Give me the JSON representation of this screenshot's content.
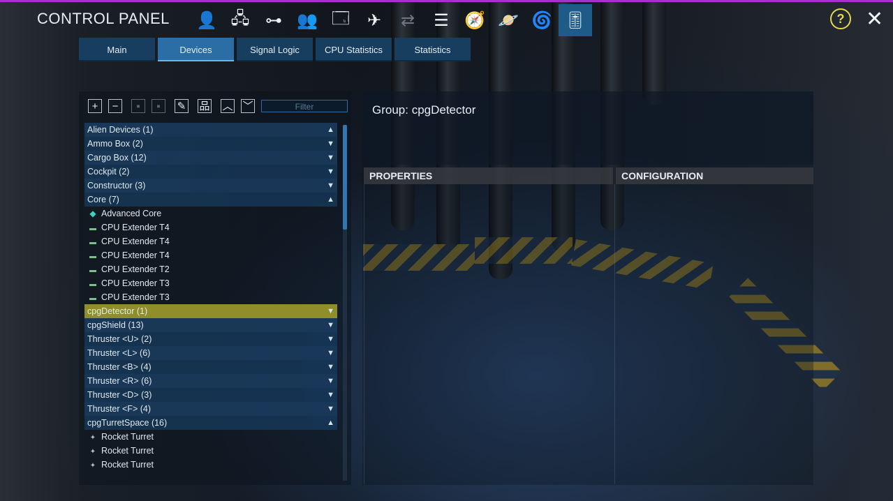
{
  "header": {
    "title": "CONTROL PANEL",
    "icons": [
      {
        "name": "player-icon",
        "glyph": "👤",
        "state": "normal"
      },
      {
        "name": "network-icon",
        "glyph": "🖧",
        "state": "normal"
      },
      {
        "name": "structure-icon",
        "glyph": "⊶",
        "state": "normal"
      },
      {
        "name": "faction-icon",
        "glyph": "👥",
        "state": "normal"
      },
      {
        "name": "window-icon",
        "glyph": "🗔",
        "state": "normal"
      },
      {
        "name": "ship-icon",
        "glyph": "✈",
        "state": "normal"
      },
      {
        "name": "transfer-icon",
        "glyph": "⇄",
        "state": "dim"
      },
      {
        "name": "list-icon",
        "glyph": "☰",
        "state": "normal"
      },
      {
        "name": "compass-icon",
        "glyph": "🧭",
        "state": "normal"
      },
      {
        "name": "planet-icon",
        "glyph": "🪐",
        "state": "normal"
      },
      {
        "name": "galaxy-icon",
        "glyph": "🌀",
        "state": "normal"
      },
      {
        "name": "sliders-icon",
        "glyph": "🎚",
        "state": "active"
      }
    ],
    "help": "?",
    "close": "✕"
  },
  "tabs": [
    {
      "label": "Main",
      "active": false
    },
    {
      "label": "Devices",
      "active": true
    },
    {
      "label": "Signal Logic",
      "active": false
    },
    {
      "label": "CPU Statistics",
      "active": false
    },
    {
      "label": "Statistics",
      "active": false
    }
  ],
  "toolbar": {
    "buttons": [
      {
        "name": "add-icon",
        "glyph": "+",
        "enabled": true
      },
      {
        "name": "remove-icon",
        "glyph": "−",
        "enabled": true
      },
      {
        "name": "copy-icon",
        "glyph": "▪",
        "enabled": false
      },
      {
        "name": "paste-icon",
        "glyph": "▪",
        "enabled": false
      },
      {
        "name": "rename-icon",
        "glyph": "✎",
        "enabled": true
      },
      {
        "name": "hierarchy-icon",
        "glyph": "品",
        "enabled": true
      },
      {
        "name": "move-up-icon",
        "glyph": "︿",
        "enabled": true
      },
      {
        "name": "move-down-icon",
        "glyph": "﹀",
        "enabled": true
      }
    ],
    "filter_placeholder": "Filter"
  },
  "devices": [
    {
      "label": "Alien Devices (1)",
      "type": "group",
      "expanded": true
    },
    {
      "label": "Ammo Box (2)",
      "type": "group",
      "expanded": false
    },
    {
      "label": "Cargo Box (12)",
      "type": "group",
      "expanded": false
    },
    {
      "label": "Cockpit (2)",
      "type": "group",
      "expanded": false
    },
    {
      "label": "Constructor (3)",
      "type": "group",
      "expanded": false
    },
    {
      "label": "Core (7)",
      "type": "group",
      "expanded": true
    },
    {
      "label": "Advanced Core",
      "type": "child",
      "icon": "core"
    },
    {
      "label": "CPU Extender T4",
      "type": "child",
      "icon": "cpu"
    },
    {
      "label": "CPU Extender T4",
      "type": "child",
      "icon": "cpu"
    },
    {
      "label": "CPU Extender T4",
      "type": "child",
      "icon": "cpu"
    },
    {
      "label": "CPU Extender T2",
      "type": "child",
      "icon": "cpu"
    },
    {
      "label": "CPU Extender T3",
      "type": "child",
      "icon": "cpu"
    },
    {
      "label": "CPU Extender T3",
      "type": "child",
      "icon": "cpu"
    },
    {
      "label": "cpgDetector (1)",
      "type": "group",
      "expanded": false,
      "selected": true
    },
    {
      "label": "cpgShield (13)",
      "type": "group",
      "expanded": false
    },
    {
      "label": "Thruster <U> (2)",
      "type": "group",
      "expanded": false
    },
    {
      "label": "Thruster <L> (6)",
      "type": "group",
      "expanded": false
    },
    {
      "label": "Thruster <B> (4)",
      "type": "group",
      "expanded": false
    },
    {
      "label": "Thruster <R> (6)",
      "type": "group",
      "expanded": false
    },
    {
      "label": "Thruster <D> (3)",
      "type": "group",
      "expanded": false
    },
    {
      "label": "Thruster <F> (4)",
      "type": "group",
      "expanded": false
    },
    {
      "label": "cpgTurretSpace (16)",
      "type": "group",
      "expanded": true
    },
    {
      "label": "Rocket Turret",
      "type": "child",
      "icon": "turret"
    },
    {
      "label": "Rocket Turret",
      "type": "child",
      "icon": "turret"
    },
    {
      "label": "Rocket Turret",
      "type": "child",
      "icon": "turret"
    }
  ],
  "detail": {
    "group_title": "Group: cpgDetector",
    "properties_label": "PROPERTIES",
    "configuration_label": "CONFIGURATION"
  },
  "colors": {
    "accent": "#a533c9",
    "tab": "#173d5f",
    "tab_active": "#2b6ea6",
    "selected_row": "#8f8e2a",
    "help": "#e6d84a"
  }
}
